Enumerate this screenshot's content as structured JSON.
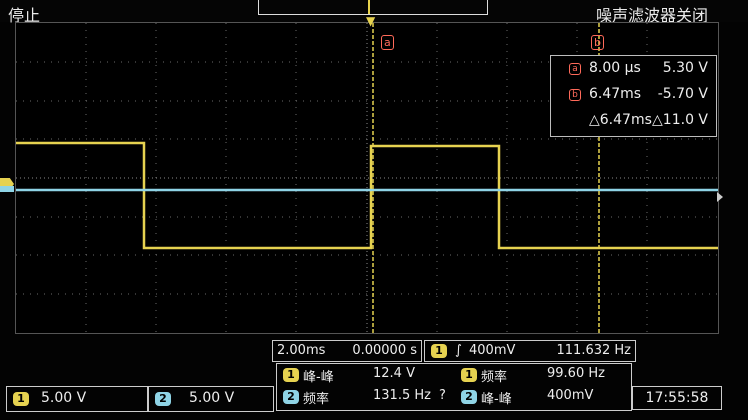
{
  "topbar": {
    "status": "停止",
    "filter": "噪声滤波器关闭"
  },
  "cursors": {
    "a_label": "a",
    "b_label": "b"
  },
  "measurements_box": {
    "row1_value1": "8.00 µs",
    "row1_value2": "5.30 V",
    "row2_value1": "6.47ms",
    "row2_value2": "-5.70 V",
    "row3_value1": "△6.47ms",
    "row3_value2": "△11.0 V"
  },
  "timebase": {
    "scale": "2.00ms",
    "delay": "0.00000 s"
  },
  "trigger": {
    "channel": "1",
    "level": "400mV",
    "frequency": "111.632 Hz"
  },
  "channels": {
    "ch1_label": "1",
    "ch1_scale": "5.00 V",
    "ch2_label": "2",
    "ch2_scale": "5.00 V"
  },
  "measures": {
    "m1_channel": "1",
    "m1_name": "峰-峰",
    "m1_value": "12.4 V",
    "m2_channel": "1",
    "m2_name": "频率",
    "m2_value": "99.60 Hz",
    "m3_channel": "2",
    "m3_name": "频率",
    "m3_value": "131.5 Hz",
    "m3_flag": "?",
    "m4_channel": "2",
    "m4_name": "峰-峰",
    "m4_value": "400mV"
  },
  "clock": "17:55:58",
  "colors": {
    "ch1": "#e6d250",
    "ch2": "#8fd4e6",
    "cursor": "#ff6a5a"
  }
}
